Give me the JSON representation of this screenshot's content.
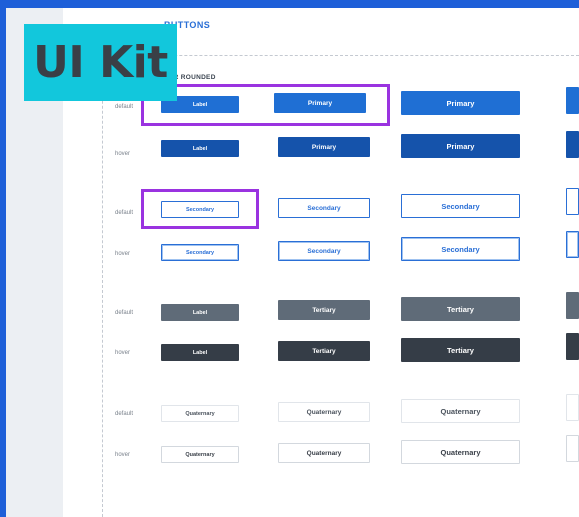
{
  "badge": {
    "text": "UI Kit"
  },
  "section": {
    "title": "BUTTONS"
  },
  "group": {
    "label": "NER ROUNDED"
  },
  "rows": [
    {
      "state": "default",
      "buttons": [
        "Label",
        "Primary",
        "Primary"
      ]
    },
    {
      "state": "hover",
      "buttons": [
        "Label",
        "Primary",
        "Primary"
      ]
    },
    {
      "state": "default",
      "buttons": [
        "Secondary",
        "Secondary",
        "Secondary"
      ]
    },
    {
      "state": "hover",
      "buttons": [
        "Secondary",
        "Secondary",
        "Secondary"
      ]
    },
    {
      "state": "default",
      "buttons": [
        "Label",
        "Tertiary",
        "Tertiary"
      ]
    },
    {
      "state": "hover",
      "buttons": [
        "Label",
        "Tertiary",
        "Tertiary"
      ]
    },
    {
      "state": "default",
      "buttons": [
        "Quaternary",
        "Quaternary",
        "Quaternary"
      ]
    },
    {
      "state": "hover",
      "buttons": [
        "Quaternary",
        "Quaternary",
        "Quaternary"
      ]
    }
  ],
  "colors": {
    "primary": "#1f6fd4",
    "primary_hover": "#1553ab",
    "secondary_border": "#2a6fd6",
    "tertiary": "#5f6b78",
    "tertiary_hover": "#353d47",
    "highlight": "#9a33e0",
    "badge": "#12c7dc"
  }
}
